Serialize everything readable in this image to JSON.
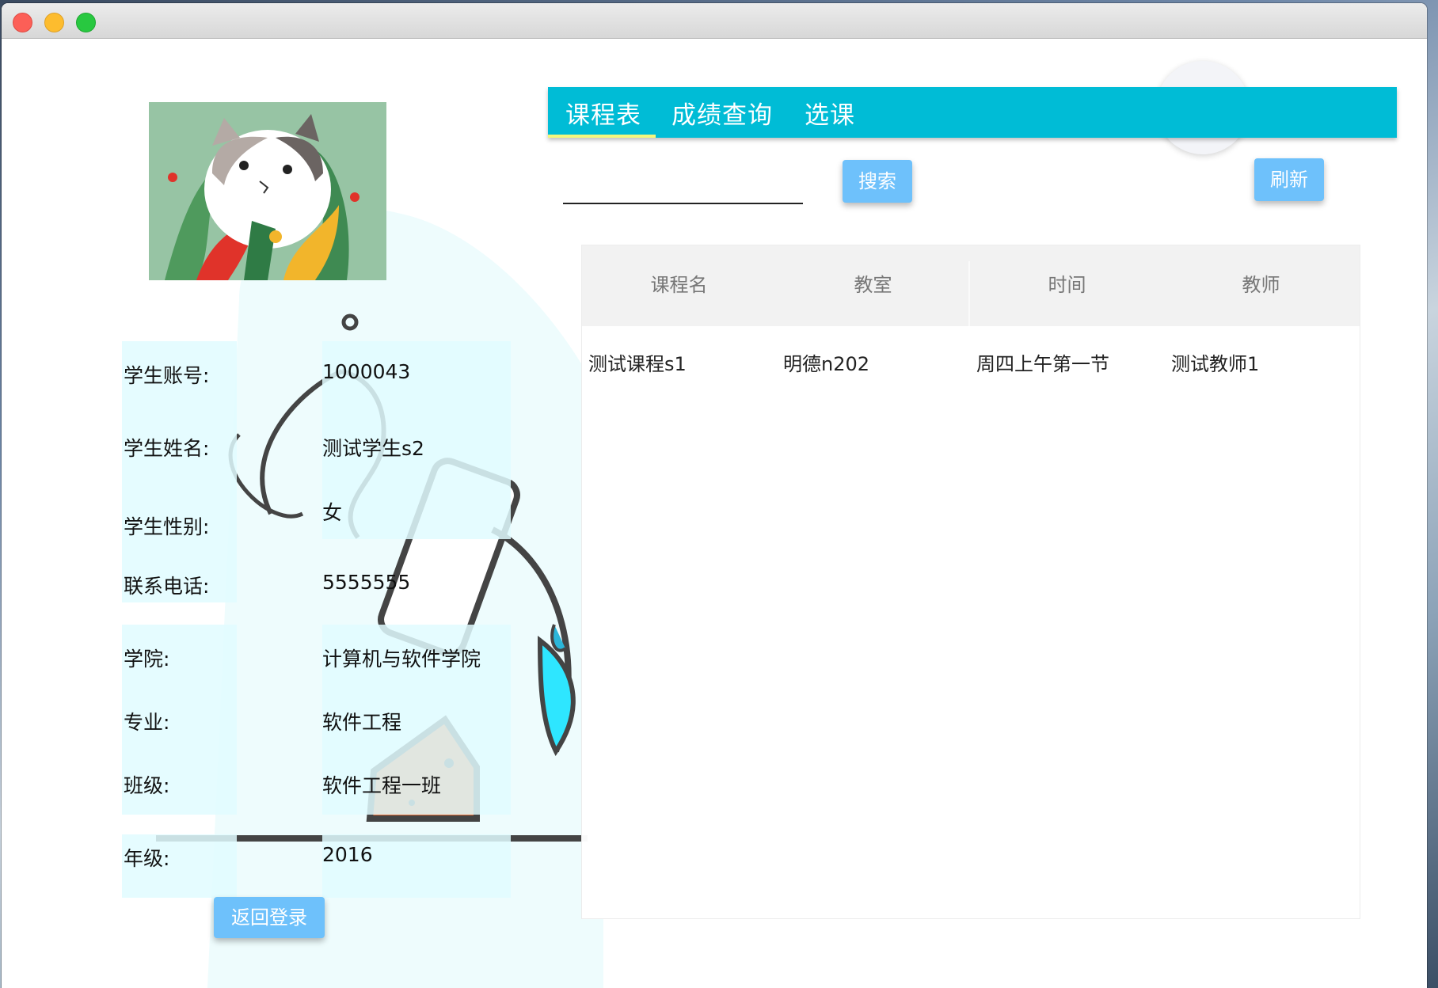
{
  "tabs": [
    "课程表",
    "成绩查询",
    "选课"
  ],
  "search": {
    "value": "",
    "button": "搜索"
  },
  "refresh_button": "刷新",
  "back_button": "返回登录",
  "student_info": [
    {
      "label": "学生账号:",
      "value": "1000043"
    },
    {
      "label": "学生姓名:",
      "value": "测试学生s2"
    },
    {
      "label": "学生性别:",
      "value": "女"
    },
    {
      "label": "联系电话:",
      "value": "5555555"
    },
    {
      "label": "学院:",
      "value": "计算机与软件学院"
    },
    {
      "label": "专业:",
      "value": "软件工程"
    },
    {
      "label": "班级:",
      "value": "软件工程一班"
    },
    {
      "label": "年级:",
      "value": "2016"
    }
  ],
  "table": {
    "headers": [
      "课程名",
      "教室",
      "时间",
      "教师"
    ],
    "rows": [
      [
        "测试课程s1",
        "明德n202",
        "周四上午第一节",
        "测试教师1"
      ]
    ]
  },
  "colors": {
    "tab_bar": "#00bcd6",
    "button": "#6ec1fb",
    "indicator": "#f5f77c",
    "cell_bg": "#e0fbff"
  },
  "icons": [
    "cat-avatar-image",
    "flask-illustration"
  ]
}
